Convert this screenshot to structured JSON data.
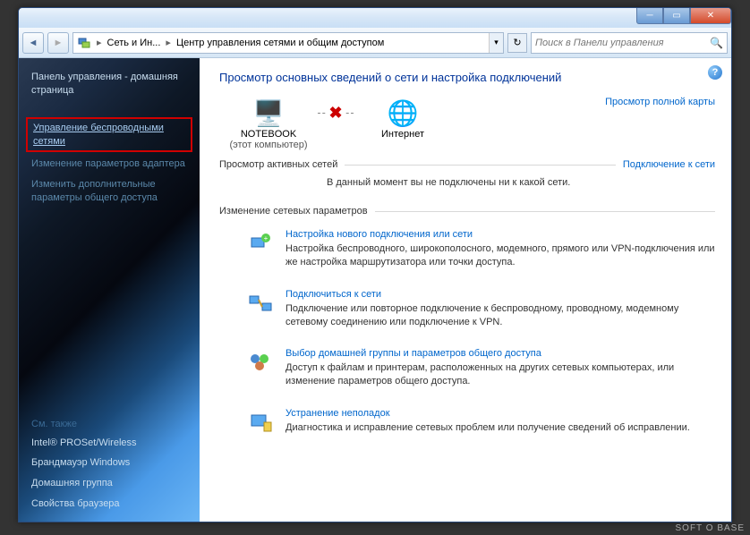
{
  "breadcrumb": {
    "seg1": "Сеть и Ин...",
    "seg2": "Центр управления сетями и общим доступом"
  },
  "search": {
    "placeholder": "Поиск в Панели управления"
  },
  "sidebar": {
    "home": "Панель управления - домашняя страница",
    "wireless": "Управление беспроводными сетями",
    "adapter": "Изменение параметров адаптера",
    "sharing": "Изменить дополнительные параметры общего доступа",
    "seealso": "См. также",
    "links": {
      "intel": "Intel® PROSet/Wireless",
      "firewall": "Брандмауэр Windows",
      "homegroup": "Домашняя группа",
      "browser": "Свойства браузера"
    }
  },
  "content": {
    "heading": "Просмотр основных сведений о сети и настройка подключений",
    "fullmap": "Просмотр полной карты",
    "node1": {
      "name": "NOTEBOOK",
      "sub": "(этот компьютер)"
    },
    "node2": {
      "name": "Интернет"
    },
    "activeTitle": "Просмотр активных сетей",
    "connectLink": "Подключение к сети",
    "activeMsg": "В данный момент вы не подключены ни к какой сети.",
    "settingsTitle": "Изменение сетевых параметров",
    "actions": [
      {
        "title": "Настройка нового подключения или сети",
        "desc": "Настройка беспроводного, широкополосного, модемного, прямого или VPN-подключения или же настройка маршрутизатора или точки доступа."
      },
      {
        "title": "Подключиться к сети",
        "desc": "Подключение или повторное подключение к беспроводному, проводному, модемному сетевому соединению или подключение к VPN."
      },
      {
        "title": "Выбор домашней группы и параметров общего доступа",
        "desc": "Доступ к файлам и принтерам, расположенных на других сетевых компьютерах, или изменение параметров общего доступа."
      },
      {
        "title": "Устранение неполадок",
        "desc": "Диагностика и исправление сетевых проблем или получение сведений об исправлении."
      }
    ]
  },
  "watermark": "SOFT O BASE"
}
